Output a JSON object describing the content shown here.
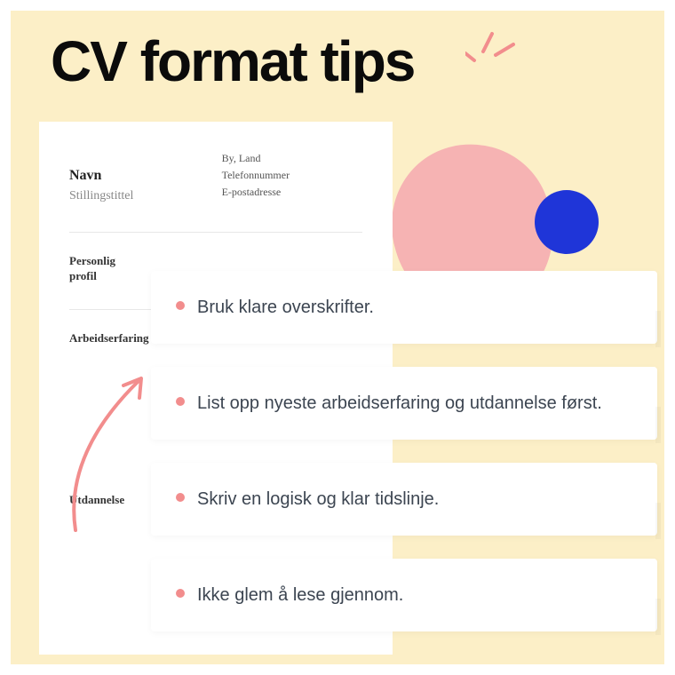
{
  "title": "CV format tips",
  "cv": {
    "name": "Navn",
    "role": "Stillingstittel",
    "contact_city": "By, Land",
    "contact_phone": "Telefonnummer",
    "contact_email": "E-postadresse",
    "section_profile_1": "Personlig",
    "section_profile_2": "profil",
    "section_work": "Arbeidserfaring",
    "section_education": "Utdannelse"
  },
  "tips": [
    "Bruk klare overskrifter.",
    "List opp nyeste arbeidserfaring og utdannelse først.",
    "Skriv en logisk og klar tidslinje.",
    "Ikke glem å lese gjennom."
  ],
  "colors": {
    "canvas": "#fcefc7",
    "pink": "#f6b3b3",
    "blue": "#1f35d8",
    "dot": "#f28d8d"
  }
}
